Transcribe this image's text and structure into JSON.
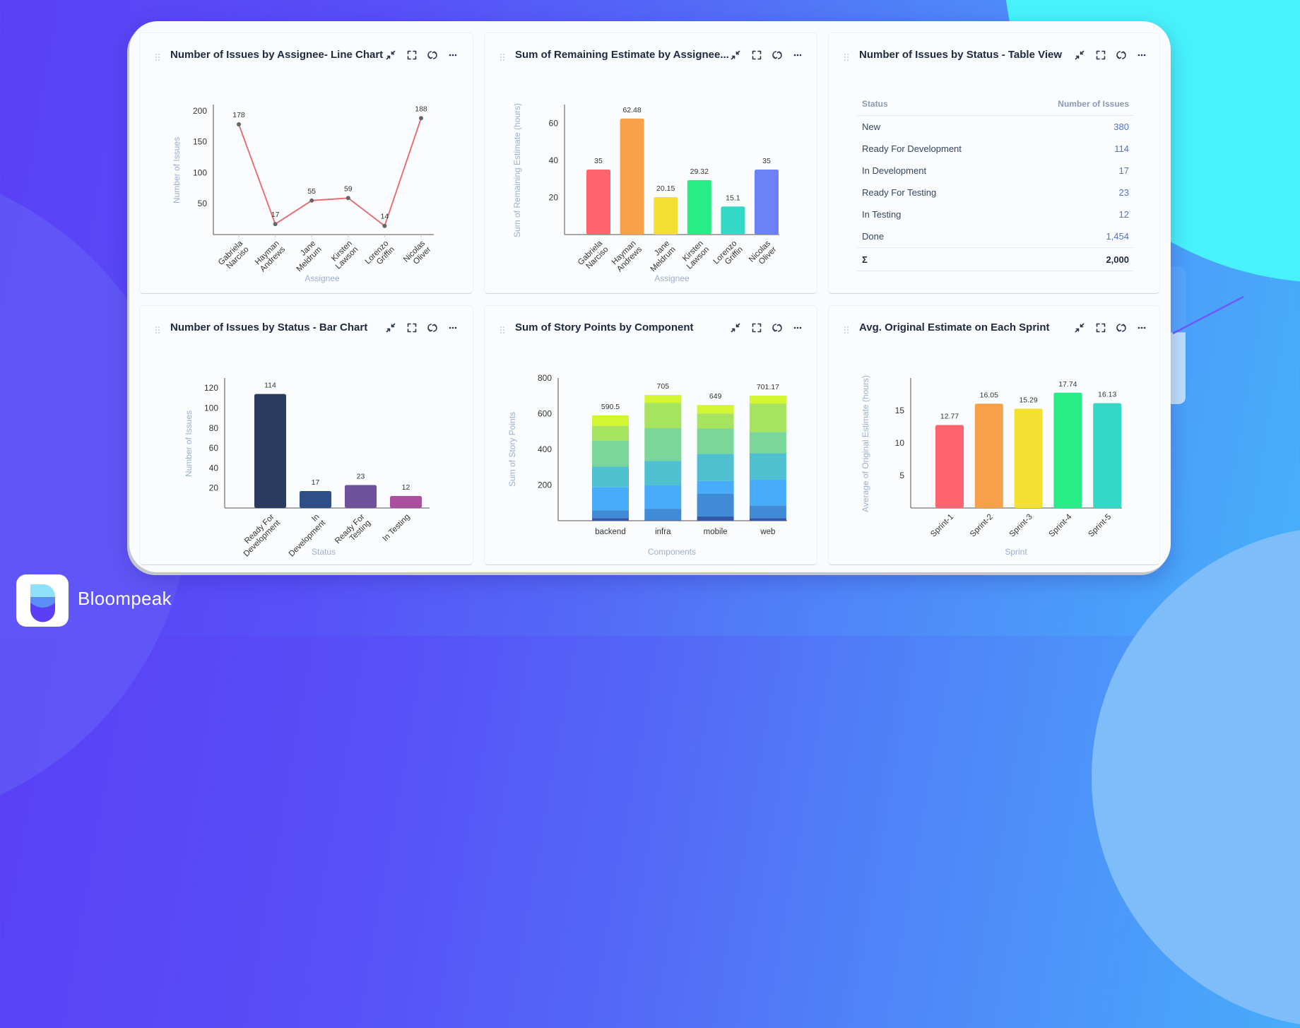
{
  "brand": {
    "name": "Bloompeak"
  },
  "chart_data": [
    {
      "type": "line",
      "title": "Number of Issues by Assignee- Line Chart",
      "xlabel": "Assignee",
      "ylabel": "Number of Issues",
      "categories": [
        "Gabriela Narciso",
        "Hayman Andrews",
        "Jane Meldrum",
        "Kirsten Lawson",
        "Lorenzo Griffin",
        "Nicolas Oliver"
      ],
      "values": [
        178,
        17,
        55,
        59,
        14,
        188
      ],
      "yticks": [
        50,
        100,
        150,
        200
      ],
      "ylim": [
        0,
        210
      ],
      "line_color": "#e8656c",
      "point_color": "#666666",
      "grid": false
    },
    {
      "type": "bar",
      "title": "Sum of Remaining Estimate by Assignee...",
      "xlabel": "Assignee",
      "ylabel": "Sum of Remaining Estimate (hours)",
      "categories": [
        "Gabriela Narciso",
        "Hayman Andrews",
        "Jane Meldrum",
        "Kirsten Lawson",
        "Lorenzo Griffin",
        "Nicolas Oliver"
      ],
      "values": [
        35,
        62.48,
        20.15,
        29.32,
        15.1,
        35
      ],
      "colors": [
        "#fe6470",
        "#f9a04a",
        "#f4e033",
        "#28ec86",
        "#34d8c6",
        "#6b81f5"
      ],
      "yticks": [
        20,
        40,
        60
      ],
      "ylim": [
        0,
        70
      ],
      "grid": false
    },
    {
      "type": "table",
      "title": "Number of Issues by Status - Table View",
      "columns": [
        "Status",
        "Number of Issues"
      ],
      "rows": [
        {
          "status": "New",
          "count": "380"
        },
        {
          "status": "Ready For Development",
          "count": "114"
        },
        {
          "status": "In Development",
          "count": "17"
        },
        {
          "status": "Ready For Testing",
          "count": "23"
        },
        {
          "status": "In Testing",
          "count": "12"
        },
        {
          "status": "Done",
          "count": "1,454"
        }
      ],
      "total_label": "Σ",
      "total_value": "2,000"
    },
    {
      "type": "bar",
      "title": "Number of Issues by Status - Bar Chart",
      "xlabel": "Status",
      "ylabel": "Number of Issues",
      "categories": [
        "Ready For Development",
        "In Development",
        "Ready For Testing",
        "In Testing"
      ],
      "values": [
        114,
        17,
        23,
        12
      ],
      "colors": [
        "#2b3b5e",
        "#2f4e86",
        "#6e529a",
        "#a94f9e"
      ],
      "yticks": [
        20,
        40,
        60,
        80,
        100,
        120
      ],
      "ylim": [
        0,
        130
      ],
      "grid": false
    },
    {
      "type": "bar",
      "stacked": true,
      "title": "Sum of Story Points by Component",
      "xlabel": "Components",
      "ylabel": "Sum of Story Points",
      "categories": [
        "backend",
        "infra",
        "mobile",
        "web"
      ],
      "totals": [
        590.5,
        705,
        649,
        701.17
      ],
      "series": [
        {
          "name": "",
          "color": "#3457a8",
          "values": [
            15,
            3,
            24,
            15
          ]
        },
        {
          "name": "",
          "color": "#3f8bd6",
          "values": [
            44,
            64,
            128,
            71
          ]
        },
        {
          "name": "",
          "color": "#47adfb",
          "values": [
            130,
            131,
            71,
            146
          ]
        },
        {
          "name": "",
          "color": "#4fc0cf",
          "values": [
            114,
            138,
            152,
            146
          ]
        },
        {
          "name": "",
          "color": "#7bd69a",
          "values": [
            147,
            183,
            142,
            120
          ]
        },
        {
          "name": "",
          "color": "#a6e35f",
          "values": [
            82,
            142,
            84,
            159
          ]
        },
        {
          "name": "",
          "color": "#d4f531",
          "values": [
            58.5,
            44,
            48,
            44.17
          ]
        }
      ],
      "yticks": [
        200,
        400,
        600,
        800
      ],
      "ylim": [
        0,
        800
      ],
      "grid": false,
      "legend": "none"
    },
    {
      "type": "bar",
      "title": "Avg. Original Estimate on Each Sprint",
      "xlabel": "Sprint",
      "ylabel": "Average of Original Estimate (hours)",
      "categories": [
        "Sprint-1",
        "Sprint-2",
        "Sprint-3",
        "Sprint-4",
        "Sprint-5"
      ],
      "values": [
        12.77,
        16.05,
        15.29,
        17.74,
        16.13
      ],
      "colors": [
        "#fe6470",
        "#f9a04a",
        "#f4e033",
        "#28ec86",
        "#34d8c6"
      ],
      "yticks": [
        5,
        10,
        15
      ],
      "ylim": [
        0,
        20
      ],
      "grid": false
    }
  ]
}
